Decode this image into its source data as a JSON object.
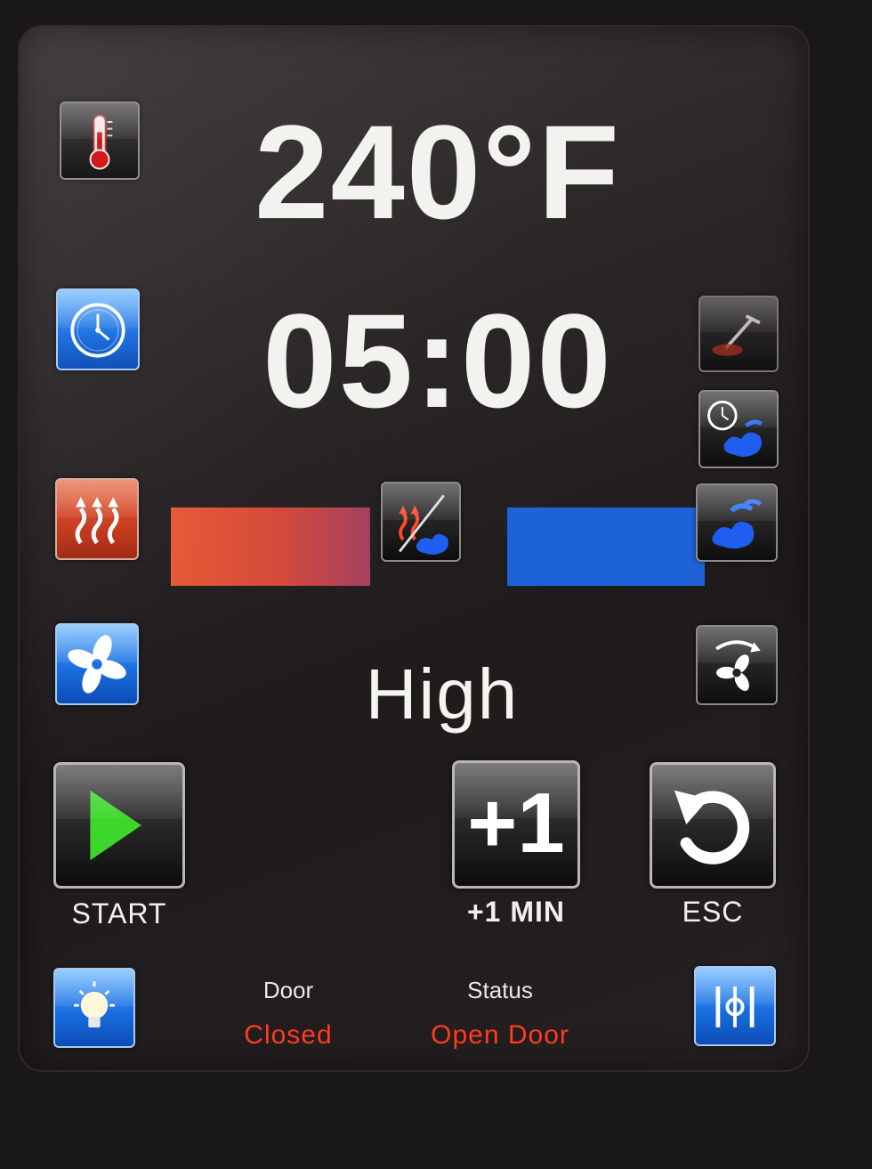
{
  "display": {
    "temperature": "240°F",
    "timer": "05:00",
    "fan_speed": "High"
  },
  "buttons": {
    "start_label": "START",
    "plus_one_symbol": "+1",
    "plus_one_label": "+1  MIN",
    "esc_label": "ESC"
  },
  "status_bar": {
    "door_label": "Door",
    "door_value": "Closed",
    "status_label": "Status",
    "status_value": "Open  Door"
  },
  "colors": {
    "heat_bar": "#e65a36",
    "steam_bar": "#1d62d8",
    "status_value": "#ff3a1e",
    "start_arrow": "#3dd62a"
  },
  "icons": [
    "thermometer-icon",
    "clock-icon",
    "probe-icon",
    "timed-steam-icon",
    "heat-icon",
    "combi-heat-steam-icon",
    "steam-icon",
    "fan-icon",
    "fan-reverse-icon",
    "play-icon",
    "plus-one-icon",
    "undo-icon",
    "light-bulb-icon",
    "settings-sliders-icon"
  ]
}
